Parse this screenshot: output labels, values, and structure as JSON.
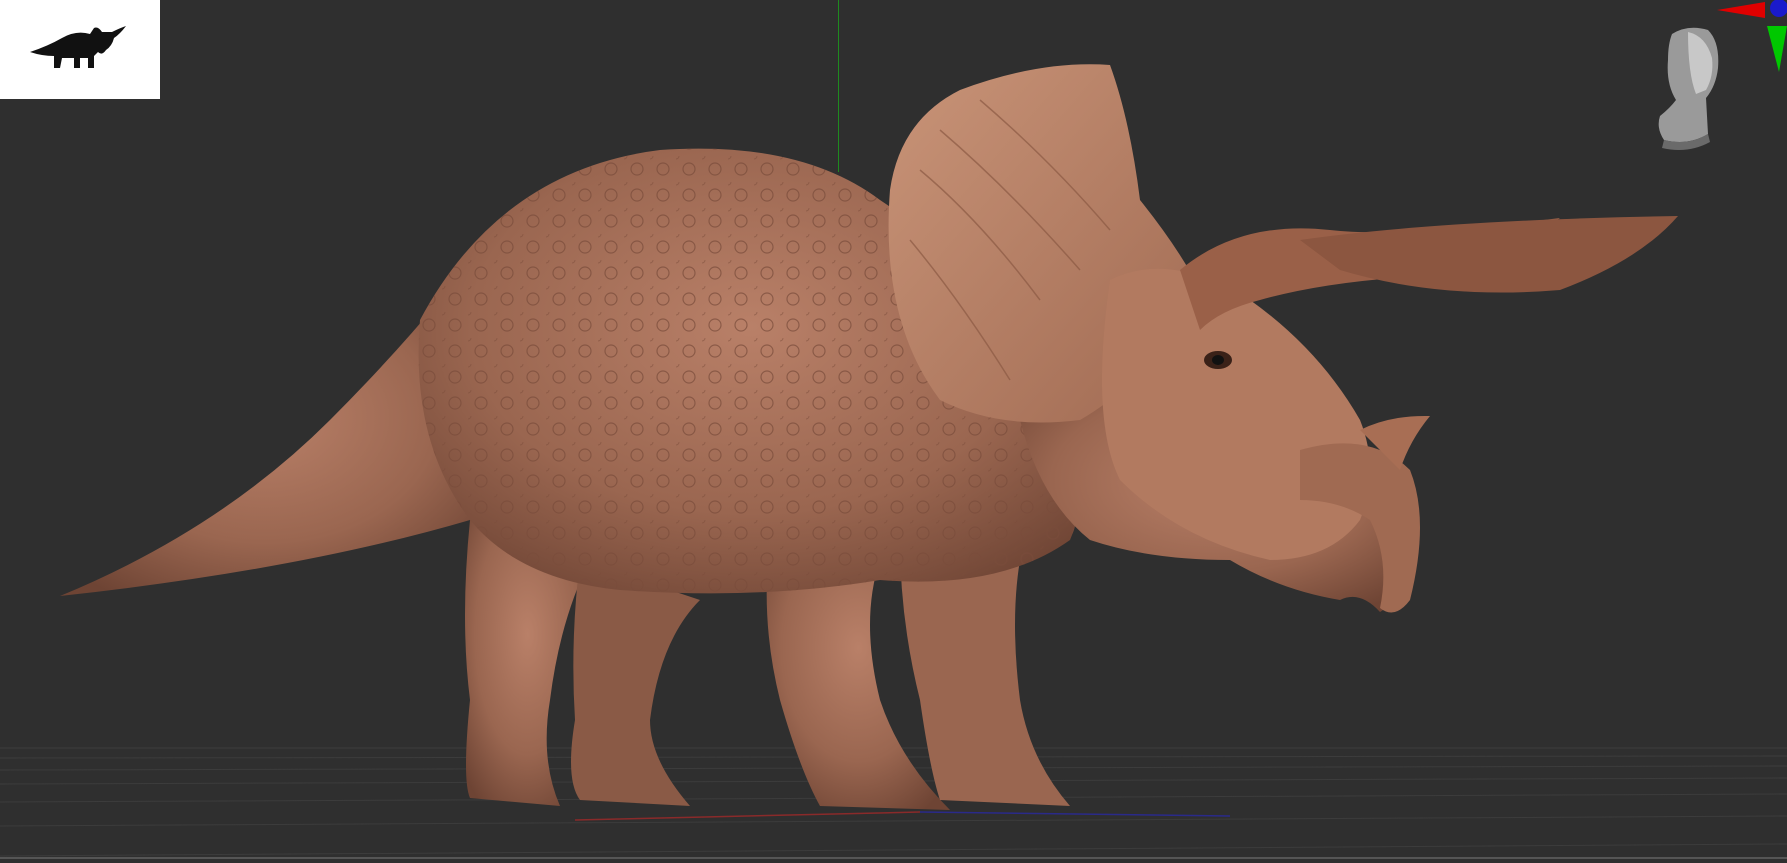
{
  "viewport": {
    "background": "#2f2f2f",
    "model_icon": "triceratops-silhouette-icon",
    "camera_gizmo_icon": "head-orientation-icon",
    "axis_icon": "xyz-axis-triad-icon",
    "skin_color": "#b07a63"
  }
}
